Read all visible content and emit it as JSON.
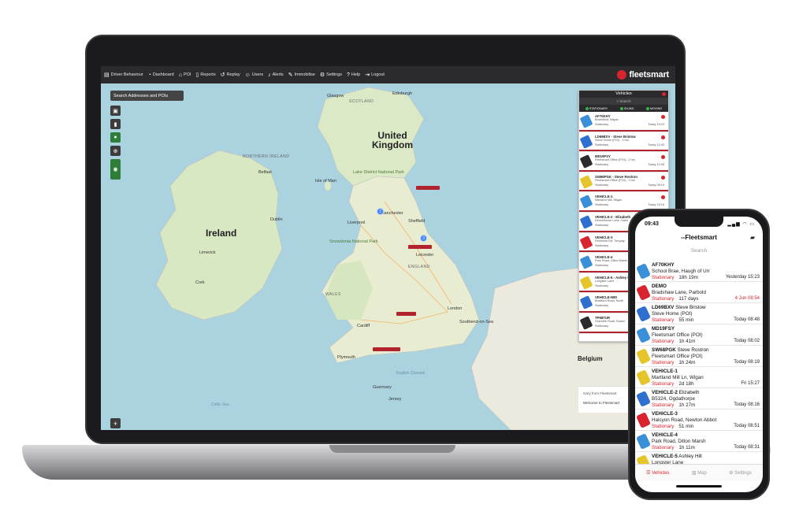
{
  "nav": {
    "items": [
      {
        "label": "Driver Behaviour",
        "icon": "chart-icon"
      },
      {
        "label": "Dashboard",
        "icon": "dashboard-icon"
      },
      {
        "label": "POI",
        "icon": "home-icon"
      },
      {
        "label": "Reports",
        "icon": "document-icon"
      },
      {
        "label": "Replay",
        "icon": "replay-icon"
      },
      {
        "label": "Users",
        "icon": "users-icon"
      },
      {
        "label": "Alerts",
        "icon": "bell-icon"
      },
      {
        "label": "Immobilise",
        "icon": "wrench-icon"
      },
      {
        "label": "Settings",
        "icon": "gear-icon"
      },
      {
        "label": "Help",
        "icon": "help-icon"
      },
      {
        "label": "Logout",
        "icon": "logout-icon"
      }
    ],
    "brand": "fleetsmart"
  },
  "map": {
    "search_label": "Search Addresses and POIs",
    "labels": {
      "uk": "United Kingdom",
      "ireland": "Ireland",
      "northern_ireland": "NORTHERN IRELAND",
      "scotland": "SCOTLAND",
      "wales": "WALES",
      "england": "ENGLAND",
      "belgium": "Belgium",
      "isle_of_man": "Isle of Man",
      "glasgow": "Glasgow",
      "edinburgh": "Edinburgh",
      "belfast": "Belfast",
      "dublin": "Dublin",
      "limerick": "Limerick",
      "cork": "Cork",
      "liverpool": "Liverpool",
      "manchester": "Manchester",
      "sheffield": "Sheffield",
      "leicester": "Leicester",
      "cardiff": "Cardiff",
      "london": "London",
      "plymouth": "Plymouth",
      "guernsey": "Guernsey",
      "jersey": "Jersey",
      "english_channel": "English Channel",
      "celtic_sea": "Celtic Sea",
      "snowdonia": "Snowdonia National Park",
      "lake_district": "Lake District National Park",
      "southend": "Southend-on-Sea"
    },
    "clusters": [
      "2",
      "3"
    ]
  },
  "vehicles_panel": {
    "title": "Vehicles",
    "search_placeholder": "Search",
    "filters": [
      "STATIONARY",
      "IDLING",
      "MOVING"
    ],
    "rows": [
      {
        "reg": "AF70KHY",
        "addr": "Brankfield, Wigan",
        "status": "Stationary",
        "time": "Today 15:23",
        "color": "#3a8fd9"
      },
      {
        "reg": "LD69BXV - Steve Bristow",
        "addr": "Steve Home (POI) - 3 hrs",
        "status": "Stationary",
        "time": "Today 12:43",
        "color": "#2f6fd0"
      },
      {
        "reg": "MD19FSY",
        "addr": "Fleetsmart Office (POI) - 2 hrs",
        "status": "Stationary",
        "time": "Today 12:08",
        "color": "#2b2b2e"
      },
      {
        "reg": "SW68PGK - Steve Rostron",
        "addr": "Fleetsmart Office (POI) - 3 hrs",
        "status": "Stationary",
        "time": "Today 08:19",
        "color": "#e5c52a"
      },
      {
        "reg": "VEHICLE-1",
        "addr": "Martland Mill, Wigan",
        "status": "Stationary",
        "time": "Today 15:16",
        "color": "#3a8fd9"
      },
      {
        "reg": "VEHICLE-2 - Elizabeth",
        "addr": "Denshhouse Lane, Oakh",
        "status": "Stationary",
        "time": "Today",
        "color": "#2f6fd0"
      },
      {
        "reg": "VEHICLE-3",
        "addr": "Parkhurst Rd, Torquay",
        "status": "Stationary",
        "time": "Today",
        "color": "#d9232e"
      },
      {
        "reg": "VEHICLE-4",
        "addr": "Park Road, Dilton Marsh",
        "status": "Stationary",
        "time": "Today",
        "color": "#3a8fd9"
      },
      {
        "reg": "VEHICLE-5 - Ashley Hi",
        "addr": "Longster Lane",
        "status": "Stationary",
        "time": "Today",
        "color": "#e5c52a"
      },
      {
        "reg": "VEHICLE-N80",
        "addr": "Bradford Road, North",
        "status": "Stationary",
        "time": "Today",
        "color": "#2f6fd0"
      },
      {
        "reg": "TP68TUR",
        "addr": "Granville Road, Burton",
        "status": "Stationary",
        "time": "Today",
        "color": "#2b2b2e"
      }
    ]
  },
  "chat": {
    "sender": "Gary from Fleetsmart",
    "message": "Welcome to Fleetsmart"
  },
  "phone": {
    "time": "09:43",
    "status_icons": "▂▄▆ ◠ ▭",
    "title": "--Fleetsmart",
    "search_placeholder": "Search",
    "rows": [
      {
        "reg": "AF70KHY",
        "name": "",
        "addr": "School Brae, Haugh of Urr",
        "status": "Stationary",
        "dur": "18h 19m",
        "time": "Yesterday 15:23",
        "time_red": false,
        "color": "#3a8fd9"
      },
      {
        "reg": "DEMO",
        "name": "",
        "addr": "Bradshaw Lane, Parbold",
        "status": "Stationary",
        "dur": "117 days",
        "time": "4 Jun 08:54",
        "time_red": true,
        "color": "#d9232e"
      },
      {
        "reg": "LD69BXV",
        "name": "Steve Bristow",
        "addr": "Steve Home (POI)",
        "status": "Stationary",
        "dur": "55 min",
        "time": "Today 08:48",
        "time_red": false,
        "color": "#2f6fd0"
      },
      {
        "reg": "MD19FSY",
        "name": "",
        "addr": "Fleetsmart Office (POI)",
        "status": "Stationary",
        "dur": "1h 41m",
        "time": "Today 08:02",
        "time_red": false,
        "color": "#3a8fd9"
      },
      {
        "reg": "SW68PGK",
        "name": "Steve Rostron",
        "addr": "Fleetsmart Office (POI)",
        "status": "Stationary",
        "dur": "1h 24m",
        "time": "Today 08:19",
        "time_red": false,
        "color": "#e5c52a"
      },
      {
        "reg": "VEHICLE-1",
        "name": "",
        "addr": "Martland Mill Ln, Wigan",
        "status": "Stationary",
        "dur": "2d 18h",
        "time": "Fri 15:27",
        "time_red": false,
        "color": "#e5c52a"
      },
      {
        "reg": "VEHICLE-2",
        "name": "Elizabeth",
        "addr": "B5324, Ogdathorpe",
        "status": "Stationary",
        "dur": "1h 27m",
        "time": "Today 08:16",
        "time_red": false,
        "color": "#2f6fd0"
      },
      {
        "reg": "VEHICLE-3",
        "name": "",
        "addr": "Halcyon Road, Newton Abbot",
        "status": "Stationary",
        "dur": "51 min",
        "time": "Today 08:51",
        "time_red": false,
        "color": "#d9232e"
      },
      {
        "reg": "VEHICLE-4",
        "name": "",
        "addr": "Park Road, Dilton Marsh",
        "status": "Stationary",
        "dur": "1h 11m",
        "time": "Today 08:31",
        "time_red": false,
        "color": "#3a8fd9"
      },
      {
        "reg": "VEHICLE-5",
        "name": "Ashley Hill",
        "addr": "Longster Lane",
        "status": "",
        "dur": "",
        "time": "",
        "time_red": false,
        "color": "#e5c52a"
      }
    ],
    "tabs": [
      "Vehicles",
      "Map",
      "Settings"
    ]
  }
}
